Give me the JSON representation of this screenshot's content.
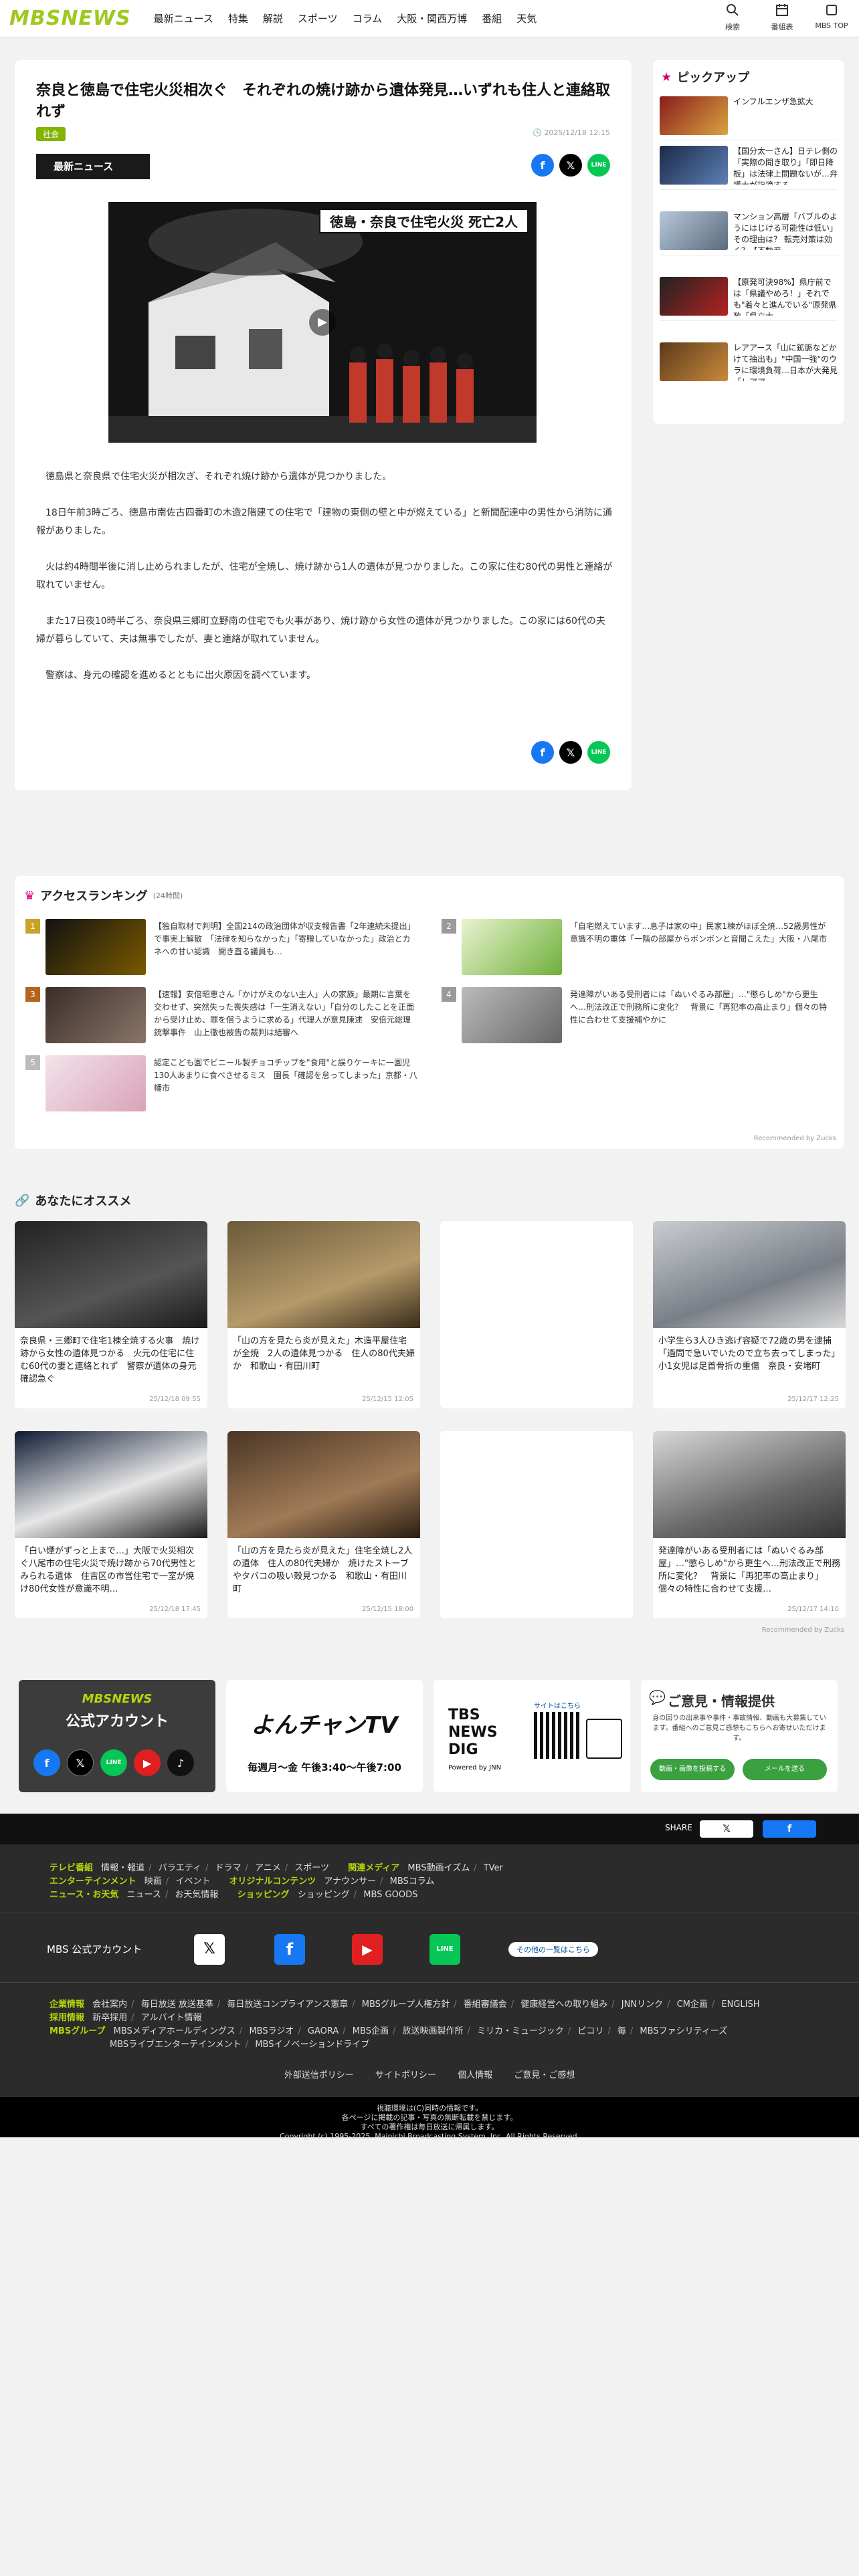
{
  "header": {
    "logo": "MBSNEWS",
    "nav": [
      "最新ニュース",
      "特集",
      "解説",
      "スポーツ",
      "コラム",
      "大阪・関西万博",
      "番組",
      "天気"
    ],
    "icons": [
      {
        "name": "search-icon",
        "label": "検索"
      },
      {
        "name": "schedule-icon",
        "label": "番組表"
      },
      {
        "name": "mbs-top-icon",
        "label": "MBS TOP"
      }
    ]
  },
  "article": {
    "title": "奈良と徳島で住宅火災相次ぐ　それぞれの焼け跡から遺体発見…いずれも住人と連絡取れず",
    "category": "社会",
    "date": "2025/12/18 12:15",
    "badge": "最新ニュース",
    "video_caption": "徳島・奈良で住宅火災 死亡2人",
    "paragraphs": [
      "徳島県と奈良県で住宅火災が相次ぎ、それぞれ焼け跡から遺体が見つかりました。",
      "18日午前3時ごろ、徳島市南佐古四番町の木造2階建ての住宅で「建物の東側の壁と中が燃えている」と新聞配達中の男性から消防に通報がありました。",
      "火は約4時間半後に消し止められましたが、住宅が全焼し、焼け跡から1人の遺体が見つかりました。この家に住む80代の男性と連絡が取れていません。",
      "また17日夜10時半ごろ、奈良県三郷町立野南の住宅でも火事があり、焼け跡から女性の遺体が見つかりました。この家には60代の夫婦が暮らしていて、夫は無事でしたが、妻と連絡が取れていません。",
      "警察は、身元の確認を進めるとともに出火原因を調べています。"
    ]
  },
  "pickup": {
    "title": "ピックアップ",
    "items": [
      "インフルエンザ急拡大",
      "【国分太一さん】日テレ側の「実際の聞き取り」「即日降板」は法律上問題ないが…弁護士が指摘する",
      "マンション高層「バブルのようにはじける可能性は低い」その理由は？ 転売対策は効く？【不動産…",
      "【原発可決98%】県庁前では「県議やめろ！」それでも\"着々と進んでいる\"原発県政「県立大…",
      "レアアース「山に鉱脈などかけて抽出も」\"中国一強\"のウラに環境負荷…日本が大発見「レアアー"
    ]
  },
  "ranking": {
    "title": "アクセスランキング",
    "sub": "(24時間)",
    "items": [
      {
        "n": "1",
        "text": "【独自取材で判明】全国214の政治団体が収支報告書「2年連続未提出」で事実上解散　「法律を知らなかった」「寄贈していなかった」政治とカネへの甘い認識　開き直る議員も…"
      },
      {
        "n": "2",
        "text": "「自宅燃えています…息子は家の中」民家1棟がほぼ全焼…52歳男性が意識不明の重体「一階の部屋からボンボンと音聞こえた」大阪・八尾市"
      },
      {
        "n": "3",
        "text": "【速報】安倍昭恵さん「かけがえのない主人」人の家族」最期に言葉を交わせず、突然失った喪失感は「一生消えない」「自分のしたことを正面から受け止め、罪を償うように求める」代理人が意見陳述　安倍元総理銃撃事件　山上徹也被告の裁判は結審へ"
      },
      {
        "n": "4",
        "text": "発達障がいある受刑者には「ぬいぐるみ部屋」…\"懲らしめ\"から更生へ…刑法改正で刑務所に変化？　背景に「再犯率の高止まり」個々の特性に合わせて支援補やかに"
      },
      {
        "n": "5",
        "text": "認定こども園でビニール製チョコチップを\"食用\"と誤りケーキに一園児130人あまりに食べさせるミス　園長「確認を怠ってしまった」京都・八幡市"
      }
    ],
    "recommended": "Recommended by Zucks"
  },
  "osusume": {
    "title": "あなたにオススメ",
    "items": [
      {
        "text": "奈良県・三郷町で住宅1棟全焼する火事　焼け跡から女性の遺体見つかる　火元の住宅に住む60代の妻と連絡とれず　警察が遺体の身元確認急ぐ",
        "date": "25/12/18 09:55"
      },
      {
        "text": "「山の方を見たら炎が見えた」木造平屋住宅が全焼　2人の遺体見つかる　住人の80代夫婦か　和歌山・有田川町",
        "date": "25/12/15 12:05"
      },
      {
        "text": "",
        "date": ""
      },
      {
        "text": "小学生ら3人ひき逃げ容疑で72歳の男を逮捕「過問で急いでいたので立ち去ってしまった」小1女児は足首骨折の重傷　奈良・安堵町",
        "date": "25/12/17 12:25"
      },
      {
        "text": "「白い煙がずっと上まで…」大阪で火災相次ぐ八尾市の住宅火災で焼け跡から70代男性とみられる遺体　住吉区の市営住宅で一室が焼け80代女性が意識不明…",
        "date": "25/12/18 17:45"
      },
      {
        "text": "「山の方を見たら炎が見えた」住宅全焼し2人の遺体　住人の80代夫婦か　焼けたストーブやタバコの吸い殻見つかる　和歌山・有田川町",
        "date": "25/12/15 18:00"
      },
      {
        "text": "",
        "date": ""
      },
      {
        "text": "発達障がいある受刑者には「ぬいぐるみ部屋」…\"懲らしめ\"から更生へ…刑法改正で刑務所に変化？　背景に「再犯率の高止まり」個々の特性に合わせて支援…",
        "date": "25/12/17 14:10"
      }
    ],
    "recommended": "Recommended by Zucks"
  },
  "banners": {
    "official": {
      "title": "MBSNEWS",
      "sub": "公式アカウント"
    },
    "yonchan": {
      "logo": "よんチャンTV",
      "time": "毎週月～金 午後3:40～午後7:00"
    },
    "tbs": {
      "logo": "TBS NEWS DIG",
      "sub": "Powered by JNN",
      "qr": "サイトはこちら"
    },
    "goiken": {
      "title": "ご意見・情報提供",
      "text": "身の回りの出来事や事件・事故情報、動画も大募集しています。番組へのご意見ご感想もこちらへお寄せいただけます。",
      "b1": "動画・画像を投稿する",
      "b2": "メールを送る"
    }
  },
  "share_bar": {
    "label": "SHARE"
  },
  "footer": {
    "rows": [
      {
        "g": "テレビ番組",
        "items": [
          "情報・報道",
          "バラエティ",
          "ドラマ",
          "アニメ",
          "スポーツ"
        ],
        "g2": "関連メディア",
        "items2": [
          "MBS動画イズム",
          "TVer"
        ]
      },
      {
        "g": "エンターテインメント",
        "items": [
          "映画",
          "イベント"
        ],
        "g2": "オリジナルコンテンツ",
        "items2": [
          "アナウンサー",
          "MBSコラム"
        ]
      },
      {
        "g": "ニュース・お天気",
        "items": [
          "ニュース",
          "お天気情報"
        ],
        "g2": "ショッピング",
        "items2": [
          "ショッピング",
          "MBS GOODS"
        ]
      }
    ],
    "official_label": "MBS 公式アカウント",
    "more": "その他の一覧はこちら",
    "corp": {
      "g": "企業情報",
      "items": [
        "会社案内",
        "毎日放送 放送基準",
        "毎日放送コンプライアンス憲章",
        "MBSグループ人権方針",
        "番組審議会",
        "健康経営への取り組み",
        "JNNリンク",
        "CM企画",
        "ENGLISH"
      ]
    },
    "recruit": {
      "g": "採用情報",
      "items": [
        "新卒採用",
        "アルバイト情報"
      ]
    },
    "group": {
      "g": "MBSグループ",
      "items": [
        "MBSメディアホールディングス",
        "MBSラジオ",
        "GAORA",
        "MBS企画",
        "放送映画製作所",
        "ミリカ・ミュージック",
        "ピコリ",
        "毎",
        "MBSファシリティーズ",
        "MBSライブエンターテインメント",
        "MBSイノベーションドライブ"
      ]
    },
    "bottom_links": [
      "外部送信ポリシー",
      "サイトポリシー",
      "個人情報",
      "ご意見・ご感想"
    ],
    "copyright": [
      "視聴環境は(C)同時の情報です。",
      "各ページに掲載の記事・写真の無断転載を禁じます。",
      "すべての著作権は毎日放送に帰属します。",
      "Copyright (c) 1995-2025, Mainichi Broadcasting System, Inc. All Rights Reserved."
    ]
  }
}
